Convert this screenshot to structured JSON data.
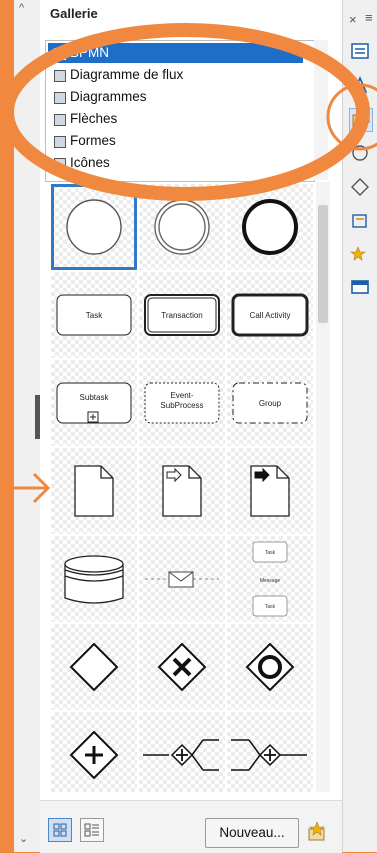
{
  "panel": {
    "title": "Gallerie",
    "categories": [
      {
        "label": "BPMN",
        "selected": true
      },
      {
        "label": "Diagramme de flux"
      },
      {
        "label": "Diagrammes"
      },
      {
        "label": "Flèches"
      },
      {
        "label": "Formes"
      },
      {
        "label": "Icônes"
      }
    ]
  },
  "shapes": [
    {
      "name": "start-event-icon"
    },
    {
      "name": "intermediate-event-icon"
    },
    {
      "name": "end-event-icon"
    },
    {
      "name": "task-shape",
      "label": "Task"
    },
    {
      "name": "transaction-shape",
      "label": "Transaction"
    },
    {
      "name": "call-activity-shape",
      "label": "Call Activity"
    },
    {
      "name": "subtask-shape",
      "label": "Subtask"
    },
    {
      "name": "event-subprocess-shape",
      "label": "Event-\nSubProcess"
    },
    {
      "name": "group-shape",
      "label": "Group"
    },
    {
      "name": "data-object-icon"
    },
    {
      "name": "data-input-icon"
    },
    {
      "name": "data-output-icon"
    },
    {
      "name": "data-store-icon"
    },
    {
      "name": "message-flow-icon"
    },
    {
      "name": "choreography-icon",
      "labels": [
        "Task",
        "Message",
        "Task"
      ]
    },
    {
      "name": "gateway-icon"
    },
    {
      "name": "exclusive-gateway-icon"
    },
    {
      "name": "inclusive-gateway-icon"
    },
    {
      "name": "parallel-gateway-icon"
    },
    {
      "name": "parallel-split-icon"
    },
    {
      "name": "parallel-fork-icon"
    }
  ],
  "toolbar": {
    "new_label": "Nouveau..."
  },
  "colors": {
    "accent": "#1e6ec8",
    "annotation": "#f1883f"
  }
}
